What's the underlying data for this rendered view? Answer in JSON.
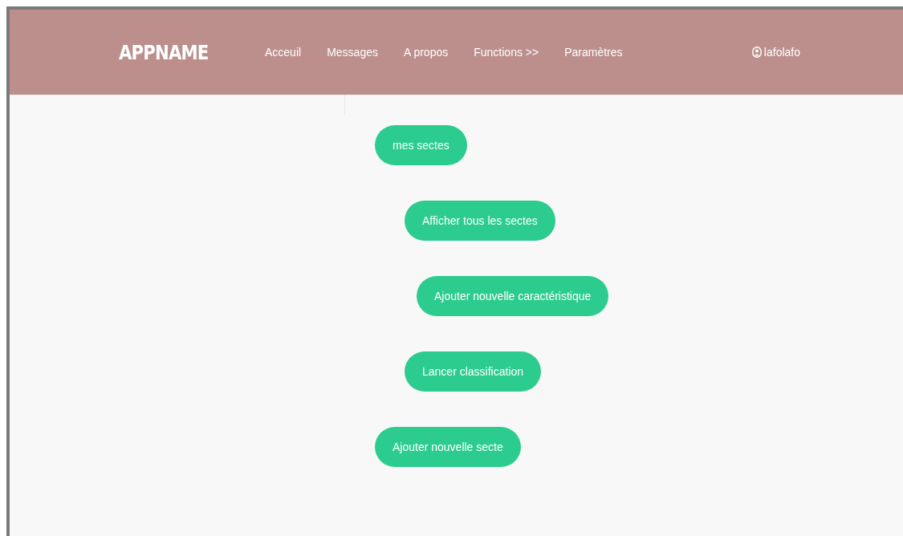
{
  "navbar": {
    "logo": "APPNAME",
    "links": [
      "Acceuil",
      "Messages",
      "A propos",
      "Functions >>",
      "Paramètres"
    ],
    "user": "lafolafo"
  },
  "actions": [
    "mes sectes",
    "Afficher tous les sectes",
    "Ajouter nouvelle caractéristique",
    "Lancer classification",
    "Ajouter nouvelle secte"
  ]
}
